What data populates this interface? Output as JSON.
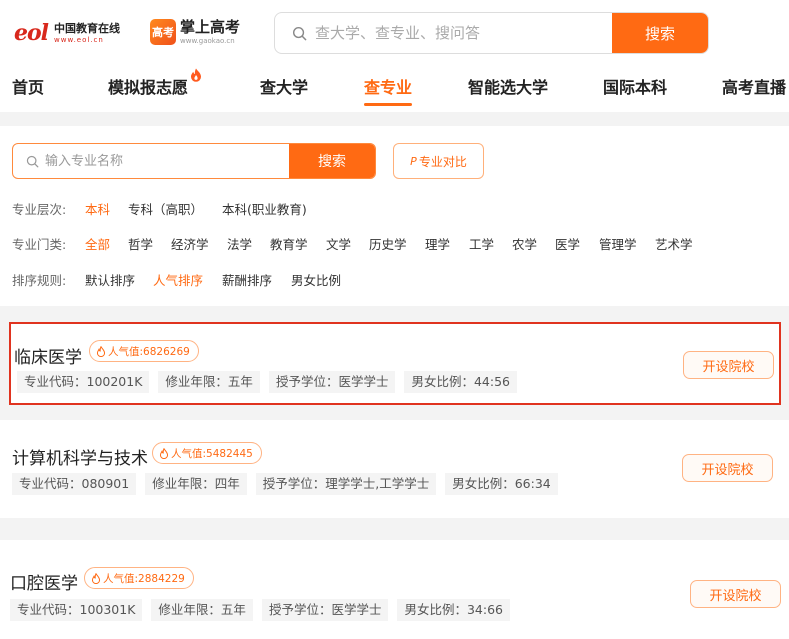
{
  "header": {
    "eol_logo": {
      "mark": "eol",
      "name": "中国教育在线",
      "url": "www.eol.cn"
    },
    "gaokao_logo": {
      "badge": "高考",
      "name": "掌上高考",
      "url": "www.gaokao.cn"
    },
    "search": {
      "placeholder": "查大学、查专业、搜问答",
      "button": "搜索",
      "icon": "search-icon"
    }
  },
  "nav": {
    "items": [
      {
        "label": "首页"
      },
      {
        "label": "模拟报志愿",
        "badge_icon": "fire-icon"
      },
      {
        "label": "查大学"
      },
      {
        "label": "查专业",
        "active": true
      },
      {
        "label": "智能选大学"
      },
      {
        "label": "国际本科"
      },
      {
        "label": "高考直播"
      }
    ]
  },
  "filter": {
    "search": {
      "placeholder": "输入专业名称",
      "button": "搜索",
      "icon": "search-icon"
    },
    "compare": {
      "icon_text": "P",
      "label": "专业对比"
    },
    "level": {
      "label": "专业层次:",
      "options": [
        "本科",
        "专科（高职）",
        "本科(职业教育)"
      ],
      "selected": "本科"
    },
    "category": {
      "label": "专业门类:",
      "options": [
        "全部",
        "哲学",
        "经济学",
        "法学",
        "教育学",
        "文学",
        "历史学",
        "理学",
        "工学",
        "农学",
        "医学",
        "管理学",
        "艺术学"
      ],
      "selected": "全部"
    },
    "sort": {
      "label": "排序规则:",
      "options": [
        "默认排序",
        "人气排序",
        "薪酬排序",
        "男女比例"
      ],
      "selected": "人气排序"
    }
  },
  "majors": [
    {
      "name": "临床医学",
      "popularity": "人气值:6826269",
      "tags": [
        "专业代码：100201K",
        "修业年限：五年",
        "授予学位：医学学士",
        "男女比例：44:56"
      ],
      "button": "开设院校",
      "highlighted": true
    },
    {
      "name": "计算机科学与技术",
      "popularity": "人气值:5482445",
      "tags": [
        "专业代码：080901",
        "修业年限：四年",
        "授予学位：理学学士,工学学士",
        "男女比例：66:34"
      ],
      "button": "开设院校"
    },
    {
      "name": "口腔医学",
      "popularity": "人气值:2884229",
      "tags": [
        "专业代码：100301K",
        "修业年限：五年",
        "授予学位：医学学士",
        "男女比例：34:66"
      ],
      "button": "开设院校"
    }
  ],
  "colors": {
    "accent": "#ff6a13",
    "highlight_border": "#e0331f",
    "logo_red": "#d8281c"
  }
}
